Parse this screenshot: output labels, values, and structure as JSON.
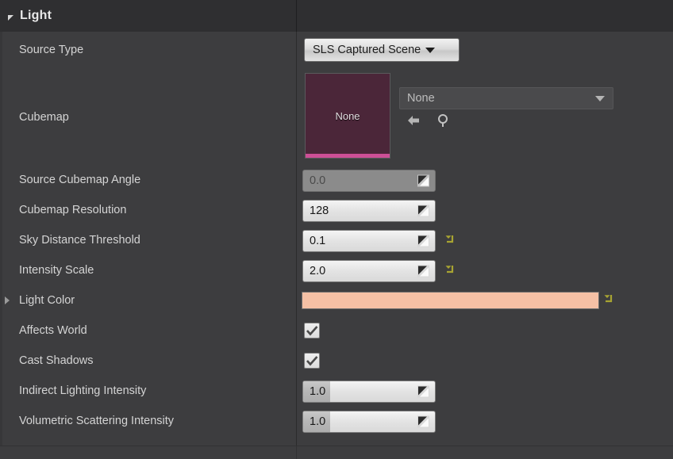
{
  "panel": {
    "category_title": "Light",
    "category_expanded_icon": "triangle-down-icon"
  },
  "colors": {
    "panel_background": "#3d3d3f",
    "header_background": "#2f2f31",
    "label_text": "#d4d4d4",
    "light_color_swatch": "#f5c0a5",
    "thumbnail_background": "#4b2639",
    "thumbnail_accent": "#cc4f96",
    "reset_arrow": "#a8a432"
  },
  "rows": [
    {
      "label": "Source Type",
      "type": "enum",
      "value": "SLS Captured Scene",
      "caret_icon": "caret-down-icon"
    },
    {
      "label": "Cubemap",
      "type": "asset",
      "thumbnail_text": "None",
      "value": "None",
      "caret_icon": "caret-down-icon",
      "use_selected_icon": "arrow-left-icon",
      "browse_icon": "magnifier-icon"
    },
    {
      "label": "Source Cubemap Angle",
      "type": "number",
      "value": "0.0",
      "disabled": true,
      "reset": false,
      "spinner_icon": "drag-spinner-icon"
    },
    {
      "label": "Cubemap Resolution",
      "type": "number",
      "value": "128",
      "disabled": false,
      "reset": false,
      "spinner_icon": "drag-spinner-icon"
    },
    {
      "label": "Sky Distance Threshold",
      "type": "number",
      "value": "0.1",
      "disabled": false,
      "reset": true,
      "spinner_icon": "drag-spinner-icon",
      "reset_icon": "reset-arrow-icon"
    },
    {
      "label": "Intensity Scale",
      "type": "number",
      "value": "2.0",
      "disabled": false,
      "reset": true,
      "spinner_icon": "drag-spinner-icon",
      "reset_icon": "reset-arrow-icon"
    },
    {
      "label": "Light Color",
      "type": "color",
      "value": "#f5c0a5",
      "expandable": true,
      "expand_icon": "triangle-right-icon",
      "reset": true,
      "reset_icon": "reset-arrow-icon"
    },
    {
      "label": "Affects World",
      "type": "checkbox",
      "checked": true,
      "check_icon": "checkmark-icon"
    },
    {
      "label": "Cast Shadows",
      "type": "checkbox",
      "checked": true,
      "check_icon": "checkmark-icon"
    },
    {
      "label": "Indirect Lighting Intensity",
      "type": "number",
      "value": "1.0",
      "disabled": false,
      "reset": false,
      "slider_fill": true,
      "spinner_icon": "drag-spinner-icon"
    },
    {
      "label": "Volumetric Scattering Intensity",
      "type": "number",
      "value": "1.0",
      "disabled": false,
      "reset": false,
      "slider_fill": true,
      "spinner_icon": "drag-spinner-icon"
    }
  ]
}
